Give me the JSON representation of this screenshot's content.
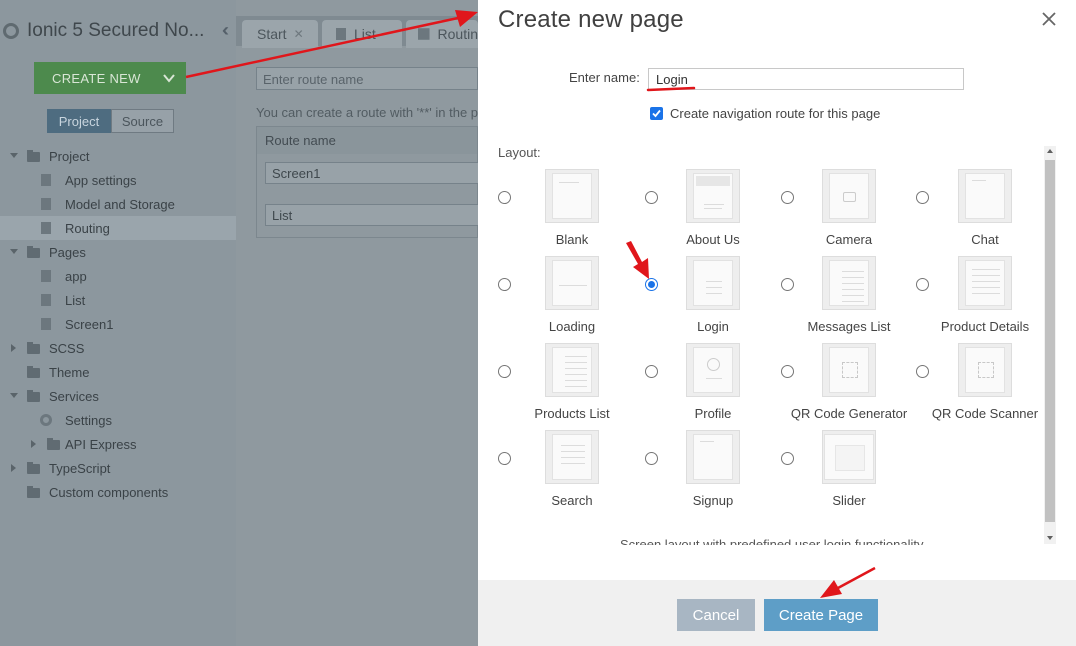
{
  "app": {
    "title": "Ionic 5 Secured No..."
  },
  "sidebar": {
    "create_new_label": "CREATE NEW",
    "segments": {
      "project": "Project",
      "source": "Source"
    },
    "tree": [
      {
        "label": "Project",
        "indent": 0,
        "kind": "folder",
        "expanded": true
      },
      {
        "label": "App settings",
        "indent": 1,
        "kind": "settings-file"
      },
      {
        "label": "Model and Storage",
        "indent": 1,
        "kind": "settings-file"
      },
      {
        "label": "Routing",
        "indent": 1,
        "kind": "settings-file",
        "selected": true
      },
      {
        "label": "Pages",
        "indent": 0,
        "kind": "folder",
        "expanded": true
      },
      {
        "label": "app",
        "indent": 1,
        "kind": "page"
      },
      {
        "label": "List",
        "indent": 1,
        "kind": "page"
      },
      {
        "label": "Screen1",
        "indent": 1,
        "kind": "page"
      },
      {
        "label": "SCSS",
        "indent": 0,
        "kind": "folder",
        "expanded": false
      },
      {
        "label": "Theme",
        "indent": 0,
        "kind": "folder-leaf"
      },
      {
        "label": "Services",
        "indent": 0,
        "kind": "folder",
        "expanded": true
      },
      {
        "label": "Settings",
        "indent": 1,
        "kind": "gear"
      },
      {
        "label": "API Express",
        "indent": 1,
        "kind": "folder",
        "expanded": false
      },
      {
        "label": "TypeScript",
        "indent": 0,
        "kind": "folder",
        "expanded": false
      },
      {
        "label": "Custom components",
        "indent": 0,
        "kind": "folder-leaf"
      }
    ]
  },
  "main": {
    "tabs": [
      {
        "label": "Start",
        "closable": true
      },
      {
        "label": "List",
        "closable": false
      },
      {
        "label": "Routin",
        "closable": false
      }
    ],
    "route_input_placeholder": "Enter route name",
    "hint": "You can create a route with '**' in the pa",
    "route_table": {
      "header": "Route name",
      "rows": [
        "Screen1",
        "List"
      ]
    }
  },
  "dialog": {
    "title": "Create new page",
    "name_label": "Enter name:",
    "name_value": "Login",
    "nav_route_label": "Create navigation route for this page",
    "nav_route_checked": true,
    "layout_label": "Layout:",
    "layouts": [
      {
        "name": "Blank",
        "icon": "blank-layout-icon"
      },
      {
        "name": "About Us",
        "icon": "about-layout-icon"
      },
      {
        "name": "Camera",
        "icon": "camera-layout-icon"
      },
      {
        "name": "Chat",
        "icon": "chat-layout-icon"
      },
      {
        "name": "Loading",
        "icon": "loading-layout-icon"
      },
      {
        "name": "Login",
        "icon": "login-layout-icon"
      },
      {
        "name": "Messages List",
        "icon": "messages-layout-icon"
      },
      {
        "name": "Product Details",
        "icon": "product-details-layout-icon"
      },
      {
        "name": "Products List",
        "icon": "products-list-layout-icon"
      },
      {
        "name": "Profile",
        "icon": "profile-layout-icon"
      },
      {
        "name": "QR Code Generator",
        "icon": "qr-generator-layout-icon"
      },
      {
        "name": "QR Code Scanner",
        "icon": "qr-scanner-layout-icon"
      },
      {
        "name": "Search",
        "icon": "search-layout-icon"
      },
      {
        "name": "Signup",
        "icon": "signup-layout-icon"
      },
      {
        "name": "Slider",
        "icon": "slider-layout-icon"
      }
    ],
    "selected_layout": "Login",
    "description": "Screen layout with predefined user login functionality",
    "cancel_label": "Cancel",
    "create_label": "Create Page"
  },
  "colors": {
    "accent_blue": "#5e9ec7",
    "annotation_red": "#e0161b",
    "create_new_green": "#4d8a4d"
  }
}
